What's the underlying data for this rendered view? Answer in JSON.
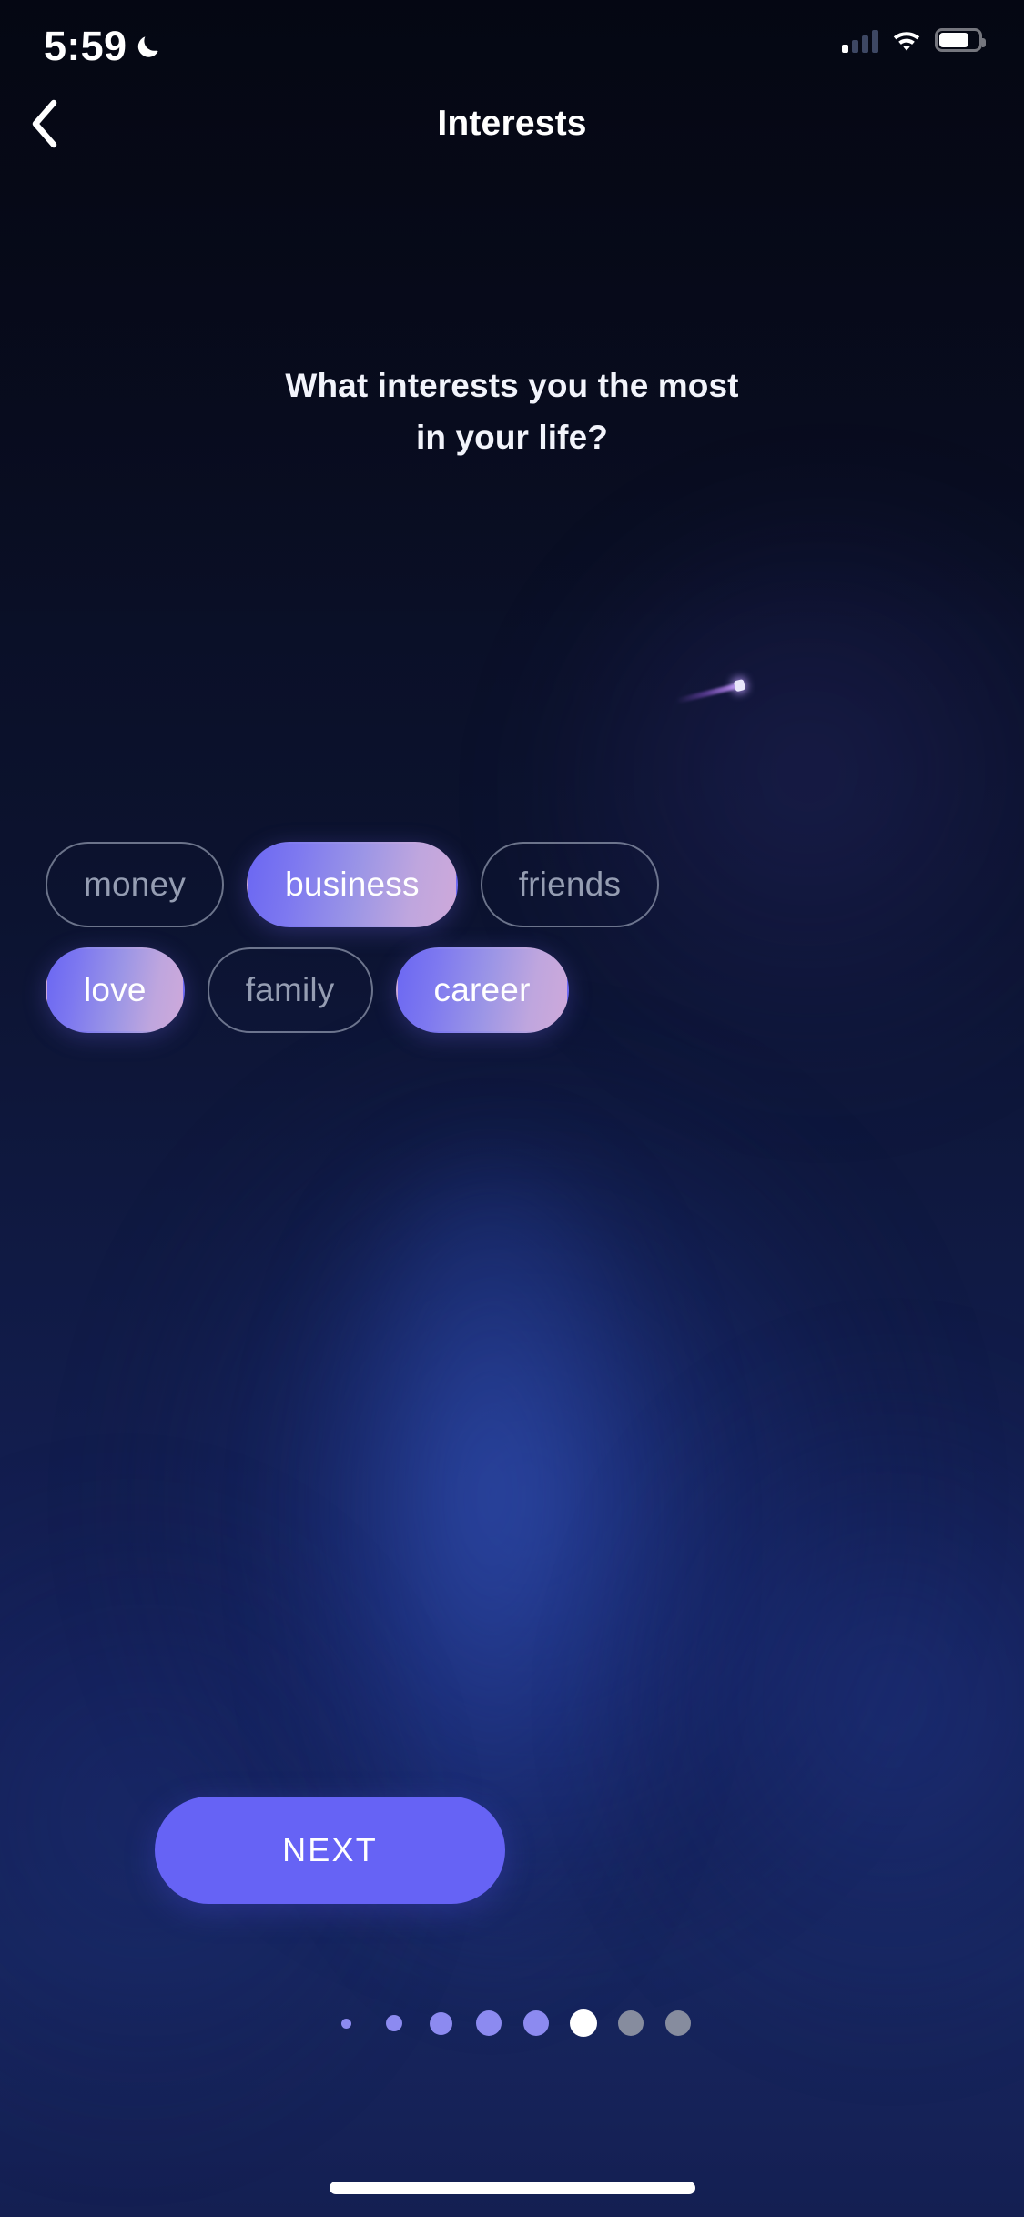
{
  "status_bar": {
    "time": "5:59",
    "dnd_icon": "crescent-moon-icon",
    "cellular_icon": "signal-bars-icon",
    "wifi_icon": "wifi-icon",
    "battery_icon": "battery-icon",
    "battery_level_percent": 72
  },
  "header": {
    "back_icon": "chevron-left-icon",
    "title": "Interests"
  },
  "main": {
    "question": "What interests you the most in your life?",
    "question_line_1": "What interests you the most",
    "question_line_2": "in your life?",
    "chips": {
      "row_1": [
        {
          "label": "money",
          "selected": false
        },
        {
          "label": "business",
          "selected": true
        },
        {
          "label": "friends",
          "selected": false
        }
      ],
      "row_2": [
        {
          "label": "love",
          "selected": true
        },
        {
          "label": "family",
          "selected": false
        },
        {
          "label": "career",
          "selected": true
        }
      ]
    },
    "decoration": {
      "comet_icon": "shooting-star-icon"
    }
  },
  "footer": {
    "next_label": "NEXT",
    "pagination": {
      "total": 8,
      "active_index": 5,
      "dots": [
        {
          "size": 11,
          "state": "past"
        },
        {
          "size": 18,
          "state": "past"
        },
        {
          "size": 25,
          "state": "past"
        },
        {
          "size": 28,
          "state": "past"
        },
        {
          "size": 28,
          "state": "past"
        },
        {
          "size": 30,
          "state": "active"
        },
        {
          "size": 28,
          "state": "upcoming"
        },
        {
          "size": 28,
          "state": "upcoming"
        }
      ]
    },
    "home_indicator": "home-indicator-bar"
  },
  "colors": {
    "accent": "#6663F5",
    "chip_gradient_start": "#6B67F2",
    "chip_gradient_end": "#CEA9DA",
    "dot_past": "#8C8AF0",
    "dot_active": "#FFFFFF",
    "dot_upcoming": "#868C9E",
    "chip_outline": "#B2BACD",
    "chip_off_text": "#959DB2",
    "background_top": "#080C1E",
    "background_bottom": "#17265F"
  }
}
